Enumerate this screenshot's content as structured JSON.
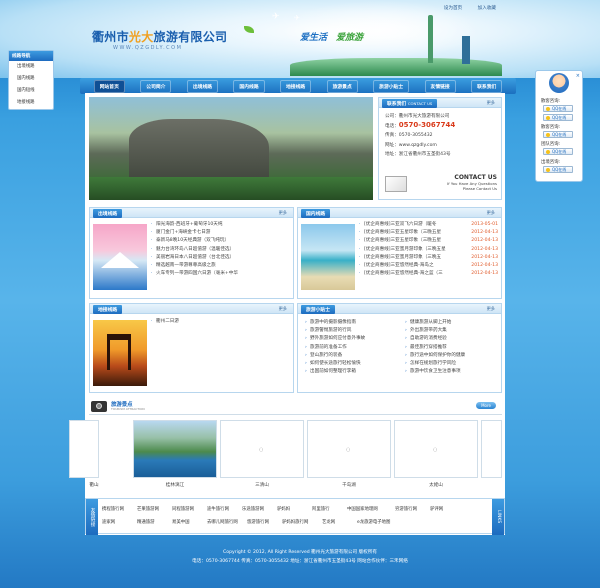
{
  "header": {
    "logo_main": "衢州市",
    "logo_highlight": "光大",
    "logo_rest": "旅游有限公司",
    "logo_url": "WWW.QZGDLY.COM",
    "slogan_green": "爱生活",
    "slogan_blue": "爱旅游",
    "toplinks": [
      "设为首页",
      "加入收藏"
    ]
  },
  "nav": {
    "items": [
      "网站首页",
      "公司简介",
      "出境线路",
      "国内线路",
      "地接线路",
      "旅游景点",
      "旅游小贴士",
      "友情链接",
      "联系我们"
    ]
  },
  "sidebar_left": {
    "title": "线路导航",
    "items": [
      "出境线路",
      "国内线路",
      "国内短线",
      "地接线路"
    ]
  },
  "contact": {
    "title": "联系我们",
    "title_en": "CONTACT US",
    "more": "更多",
    "company": "公司：衢州市光大旅游有限公司",
    "phone_label": "电话：",
    "phone": "0570-3067744",
    "fax": "传真：0570-3055432",
    "web": "网址：www.qzgdly.com",
    "address": "地址：浙江省衢州市五圣街43号",
    "cta_title": "CONTACT US",
    "cta_line1": "If You Have Any Questions",
    "cta_line2": "Please Contact Us"
  },
  "outbound": {
    "title": "出境线路",
    "more": "更多",
    "items": [
      "阳光海韵-西班牙+葡萄牙10天纯",
      "厦门金门+海峡金卡七日游",
      "泰新马8晚10天经典游（双飞纯玩）",
      "魅力台湾环岛八日超值游（温暖佳选）",
      "美丽岩海日本八日超值游（台北佳选）",
      "精选越南一带游尊尊高级之旅",
      "火车专列一带游四国六日游（毫米+中华"
    ]
  },
  "domestic": {
    "title": "国内线路",
    "more": "更多",
    "items": [
      {
        "text": "[优企商惠线]三亚双飞六日游（暖冬",
        "date": "2013-05-01"
      },
      {
        "text": "[优企商惠线]三亚五星印象（三晚五星",
        "date": "2012-04-13"
      },
      {
        "text": "[优企商惠线]三亚五星印象（三晚五星",
        "date": "2012-04-13"
      },
      {
        "text": "[优企商惠线]三亚蜜月游印象（三晚五星",
        "date": "2012-04-13"
      },
      {
        "text": "[优企商惠线]三亚蜜月游印象（三晚五",
        "date": "2012-04-13"
      },
      {
        "text": "[优企商惠线]三亚悠然经典-海岛之",
        "date": "2012-04-13"
      },
      {
        "text": "[优企商惠线]三亚悠然经典-海之蓝（三",
        "date": "2012-04-13"
      }
    ]
  },
  "local": {
    "title": "地接线路",
    "more": "更多",
    "items": [
      "衢州二日游"
    ]
  },
  "tips": {
    "title": "旅游小贴士",
    "more": "更多",
    "left": [
      "旅游中的摄影摄像指南",
      "旅游警惕旅游的行风",
      "野外旅游如何应付意外事故",
      "旅游前的准备工作",
      "登山旅行的装备",
      "如何使长途旅行轻松愉快",
      "出国前如何整理行李箱"
    ],
    "right": [
      "健康旅游从脚上开始",
      "外出旅游带药大集",
      "自助游的消费经验",
      "最佳旅行穿搭推荐",
      "旅行途中如何保护你的健康",
      "怎样在规划旅行学风险",
      "旅游中饮食卫生注意事项"
    ]
  },
  "scenic": {
    "title": "旅游景点",
    "subtitle": "TOURISM ATTRACTION",
    "more": "More",
    "items": [
      "衢山",
      "桂林漓江",
      "三清山",
      "千岛湖",
      "太姥山"
    ]
  },
  "friend_links": {
    "tag": "友情链接",
    "tag_en": "LINKS",
    "items": [
      "携程旅行网",
      "芒果旅游网",
      "同程旅游网",
      "途牛旅行网",
      "乐途旅游网",
      "驴妈妈",
      "阿里旅行",
      "中国国家地理网",
      "穷游旅行网",
      "驴评网",
      "途家网",
      "精通旅游",
      "易美中国",
      "去哪儿网旅行网",
      "悠游旅行网",
      "驴妈妈旅行网",
      "艺龙网",
      "e龙旅游电子地图"
    ]
  },
  "footer": {
    "line1": "Copyright © 2012, All Right Reserved 衢州光大旅游有限公司 版权所有",
    "line2": "电话：0570-3067744  传真：0570-3055432  地址：浙江省衢州市五圣街43号 网站合作伙伴：三禾网络"
  },
  "qq_panel": {
    "groups": [
      {
        "label": "散客咨询:",
        "buttons": [
          "QQ在线",
          "QQ在线"
        ]
      },
      {
        "label": "散客咨询:",
        "buttons": [
          "QQ在线"
        ]
      },
      {
        "label": "团队咨询:",
        "buttons": [
          "QQ在线"
        ]
      },
      {
        "label": "出境咨询:",
        "buttons": [
          "QQ在线"
        ]
      }
    ]
  }
}
